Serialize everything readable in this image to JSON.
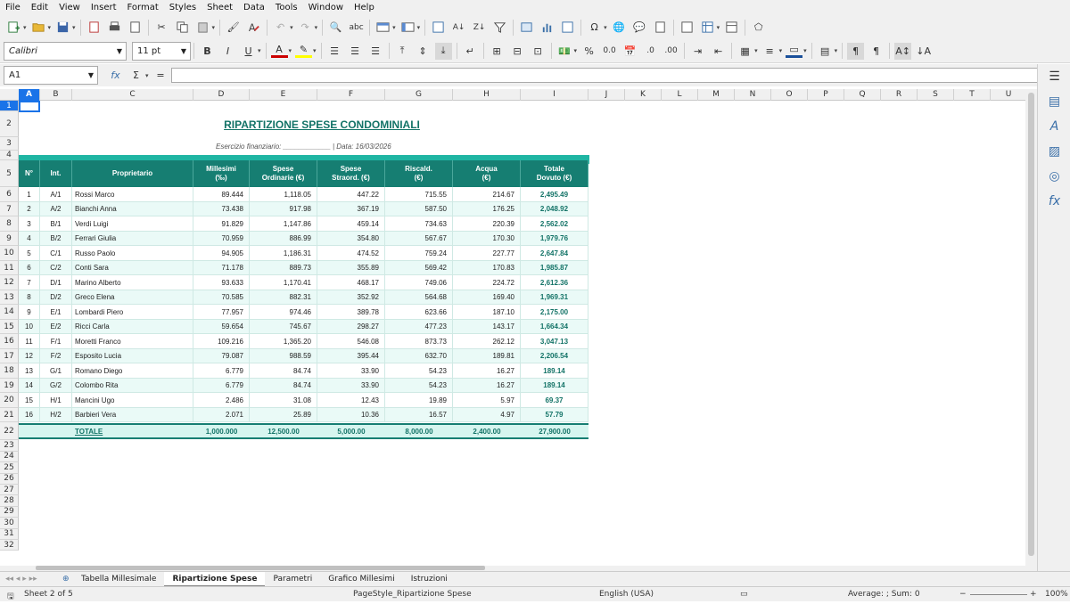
{
  "menu": [
    "File",
    "Edit",
    "View",
    "Insert",
    "Format",
    "Styles",
    "Sheet",
    "Data",
    "Tools",
    "Window",
    "Help"
  ],
  "toolbar2": {
    "font_name": "Calibri",
    "font_size": "11 pt"
  },
  "formula_bar": {
    "cell_ref": "A1",
    "fx": "fx",
    "sigma": "Σ",
    "eq": "=",
    "content": ""
  },
  "columns": [
    "A",
    "B",
    "C",
    "D",
    "E",
    "F",
    "G",
    "H",
    "I",
    "J",
    "K",
    "L",
    "M",
    "N",
    "O",
    "P",
    "Q",
    "R",
    "S",
    "T",
    "U"
  ],
  "rows": [
    "1",
    "2",
    "3",
    "4",
    "5",
    "6",
    "7",
    "8",
    "9",
    "10",
    "11",
    "12",
    "13",
    "14",
    "15",
    "16",
    "17",
    "18",
    "19",
    "20",
    "21",
    "22",
    "23",
    "24",
    "25",
    "26",
    "27",
    "28",
    "29",
    "30",
    "31",
    "32"
  ],
  "sheet": {
    "title": "RIPARTIZIONE SPESE CONDOMINIALI",
    "exercise": "Esercizio finanziario: ____________",
    "date": "| Data: 16/03/2026",
    "headers": [
      "N°",
      "Int.",
      "Proprietario",
      "Millesimi\n(‰)",
      "Spese\nOrdinarie (€)",
      "Spese\nStraord. (€)",
      "Riscald.\n(€)",
      "Acqua\n(€)",
      "Totale\nDovuto (€)"
    ],
    "rows": [
      [
        "1",
        "A/1",
        "Rossi Marco",
        "89.444",
        "1,118.05",
        "447.22",
        "715.55",
        "214.67",
        "2,495.49"
      ],
      [
        "2",
        "A/2",
        "Bianchi Anna",
        "73.438",
        "917.98",
        "367.19",
        "587.50",
        "176.25",
        "2,048.92"
      ],
      [
        "3",
        "B/1",
        "Verdi Luigi",
        "91.829",
        "1,147.86",
        "459.14",
        "734.63",
        "220.39",
        "2,562.02"
      ],
      [
        "4",
        "B/2",
        "Ferrari Giulia",
        "70.959",
        "886.99",
        "354.80",
        "567.67",
        "170.30",
        "1,979.76"
      ],
      [
        "5",
        "C/1",
        "Russo Paolo",
        "94.905",
        "1,186.31",
        "474.52",
        "759.24",
        "227.77",
        "2,647.84"
      ],
      [
        "6",
        "C/2",
        "Conti Sara",
        "71.178",
        "889.73",
        "355.89",
        "569.42",
        "170.83",
        "1,985.87"
      ],
      [
        "7",
        "D/1",
        "Marino Alberto",
        "93.633",
        "1,170.41",
        "468.17",
        "749.06",
        "224.72",
        "2,612.36"
      ],
      [
        "8",
        "D/2",
        "Greco Elena",
        "70.585",
        "882.31",
        "352.92",
        "564.68",
        "169.40",
        "1,969.31"
      ],
      [
        "9",
        "E/1",
        "Lombardi Piero",
        "77.957",
        "974.46",
        "389.78",
        "623.66",
        "187.10",
        "2,175.00"
      ],
      [
        "10",
        "E/2",
        "Ricci Carla",
        "59.654",
        "745.67",
        "298.27",
        "477.23",
        "143.17",
        "1,664.34"
      ],
      [
        "11",
        "F/1",
        "Moretti Franco",
        "109.216",
        "1,365.20",
        "546.08",
        "873.73",
        "262.12",
        "3,047.13"
      ],
      [
        "12",
        "F/2",
        "Esposito Lucia",
        "79.087",
        "988.59",
        "395.44",
        "632.70",
        "189.81",
        "2,206.54"
      ],
      [
        "13",
        "G/1",
        "Romano Diego",
        "6.779",
        "84.74",
        "33.90",
        "54.23",
        "16.27",
        "189.14"
      ],
      [
        "14",
        "G/2",
        "Colombo Rita",
        "6.779",
        "84.74",
        "33.90",
        "54.23",
        "16.27",
        "189.14"
      ],
      [
        "15",
        "H/1",
        "Mancini Ugo",
        "2.486",
        "31.08",
        "12.43",
        "19.89",
        "5.97",
        "69.37"
      ],
      [
        "16",
        "H/2",
        "Barbieri Vera",
        "2.071",
        "25.89",
        "10.36",
        "16.57",
        "4.97",
        "57.79"
      ]
    ],
    "totals": [
      "",
      "",
      "TOTALE",
      "1,000.000",
      "12,500.00",
      "5,000.00",
      "8,000.00",
      "2,400.00",
      "27,900.00"
    ]
  },
  "tabs": [
    "Tabella Millesimale",
    "Ripartizione Spese",
    "Parametri",
    "Grafico Millesimi",
    "Istruzioni"
  ],
  "active_tab": "Ripartizione Spese",
  "status": {
    "sheet": "Sheet 2 of 5",
    "page_style": "PageStyle_Ripartizione Spese",
    "language": "English (USA)",
    "sum": "Average: ; Sum: 0",
    "zoom": "100%"
  },
  "colors": {
    "header_teal": "#167e72",
    "band": "#1fb5a3",
    "alt_row": "#eafaf7",
    "total_text": "#137367"
  }
}
